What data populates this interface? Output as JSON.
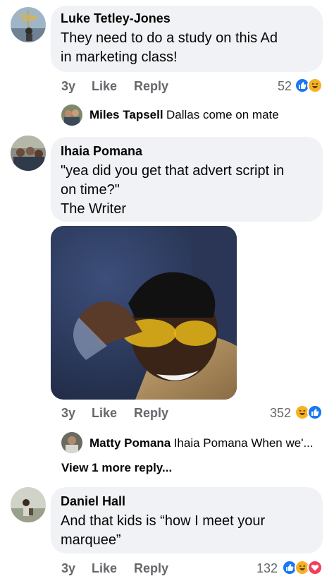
{
  "comments": [
    {
      "author": "Luke Tetley-Jones",
      "lines": [
        "They need to do a study on this Ad",
        "in marketing class!"
      ],
      "age": "3y",
      "like": "Like",
      "reply": "Reply",
      "reactions_count": "52",
      "reactions": [
        "like-icon",
        "haha-icon"
      ],
      "reply_preview": {
        "author": "Miles Tapsell",
        "text": "Dallas come on mate"
      }
    },
    {
      "author": "Ihaia Pomana",
      "lines": [
        "\"yea did you get that advert script in",
        "on time?\"",
        "The Writer"
      ],
      "age": "3y",
      "like": "Like",
      "reply": "Reply",
      "reactions_count": "352",
      "reactions": [
        "haha-icon",
        "like-icon"
      ],
      "reply_preview": {
        "author": "Matty Pomana",
        "text": "Ihaia Pomana When we'..."
      },
      "more_replies": "View 1 more reply..."
    },
    {
      "author": "Daniel Hall",
      "lines": [
        "And that kids is “how I meet your",
        "marquee”"
      ],
      "age": "3y",
      "like": "Like",
      "reply": "Reply",
      "reactions_count": "132",
      "reactions": [
        "like-icon",
        "haha-icon",
        "love-icon"
      ]
    }
  ],
  "colors": {
    "like": "#1877f2",
    "haha": "#f7b125",
    "love": "#f33e58",
    "bubble": "#f0f2f5",
    "meta": "#65676b"
  }
}
